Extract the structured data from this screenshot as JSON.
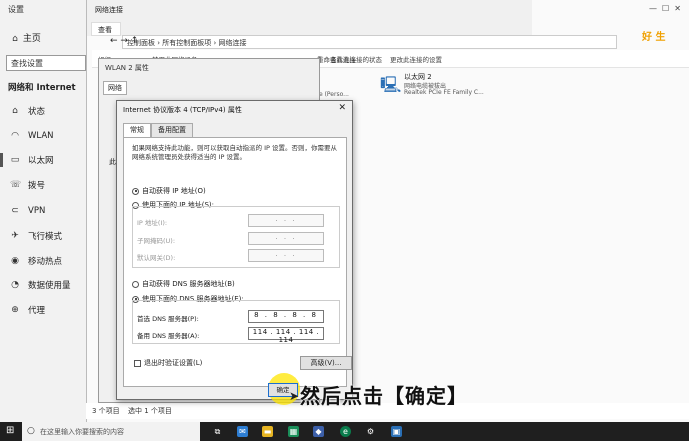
{
  "settings": {
    "title": "设置",
    "home": "主页",
    "search_placeholder": "查找设置",
    "section": "网络和 Internet",
    "items": [
      {
        "label": "状态",
        "icon": "home-icon"
      },
      {
        "label": "WLAN",
        "icon": "wifi-icon"
      },
      {
        "label": "以太网",
        "icon": "ethernet-icon"
      },
      {
        "label": "拨号",
        "icon": "dialup-icon"
      },
      {
        "label": "VPN",
        "icon": "vpn-icon"
      },
      {
        "label": "飞行模式",
        "icon": "airplane-icon"
      },
      {
        "label": "移动热点",
        "icon": "hotspot-icon"
      },
      {
        "label": "数据使用量",
        "icon": "data-usage-icon"
      },
      {
        "label": "代理",
        "icon": "globe-icon"
      }
    ]
  },
  "netwin": {
    "tab_title": "网络连接",
    "tab_label": "查看",
    "address": "控制面板  ›  所有控制面板项  ›  网络连接",
    "toolbar": [
      "组织",
      "禁用此网络设备",
      "诊断这个连接",
      "重命名此连接",
      "查看此连接的状态",
      "更改此连接的设置"
    ],
    "adapter_name": "以太网 2",
    "adapter_status": "网络电缆被拔出",
    "adapter_desc": "Realtek PCIe FE Family C...",
    "status_left": "3 个项目",
    "status_sel": "选中 1 个项目",
    "side_text": "ice (Perso..."
  },
  "wlanprop": {
    "title": "WLAN 2 属性",
    "tab": "网络",
    "side_label": "此"
  },
  "ipv4": {
    "title": "Internet 协议版本 4 (TCP/IPv4) 属性",
    "tabs": [
      "常规",
      "备用配置"
    ],
    "desc": "如果网络支持此功能，则可以获取自动指派的 IP 设置。否则，你需要从网络系统管理员处获得适当的 IP 设置。",
    "auto_ip": "自动获得 IP 地址(O)",
    "manual_ip": "使用下面的 IP 地址(S):",
    "ip_label": "IP 地址(I):",
    "mask_label": "子网掩码(U):",
    "gw_label": "默认网关(D):",
    "auto_dns": "自动获得 DNS 服务器地址(B)",
    "manual_dns": "使用下面的 DNS 服务器地址(E):",
    "dns1_label": "首选 DNS 服务器(P):",
    "dns1": "8  .  8  .  8  .  8",
    "dns2_label": "备用 DNS 服务器(A):",
    "dns2": "114 . 114 . 114 . 114",
    "empty_ip": ".   .   .",
    "validate": "退出时验证设置(L)",
    "advanced": "高级(V)...",
    "ok": "确定"
  },
  "caption": "然后点击【确定】",
  "taskbar": {
    "search": "在这里输入你要搜索的内容"
  },
  "logo": "好 生"
}
